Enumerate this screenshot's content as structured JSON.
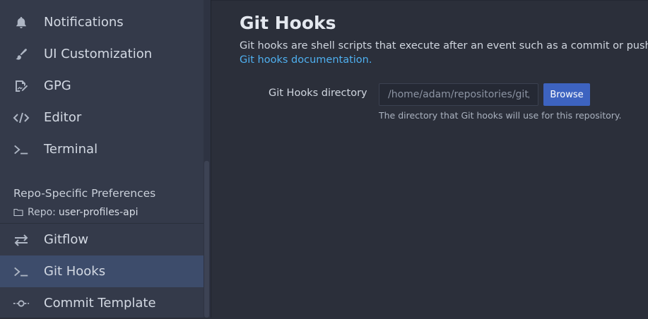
{
  "sidebar": {
    "global_items": [
      {
        "label": "Notifications",
        "icon": "bell-icon"
      },
      {
        "label": "UI Customization",
        "icon": "paintbrush-icon"
      },
      {
        "label": "GPG",
        "icon": "signature-icon"
      },
      {
        "label": "Editor",
        "icon": "code-icon"
      },
      {
        "label": "Terminal",
        "icon": "terminal-icon"
      }
    ],
    "repo_section": {
      "title": "Repo-Specific Preferences",
      "repo_prefix": "Repo:",
      "repo_name": "user-profiles-api"
    },
    "repo_items": [
      {
        "label": "Gitflow",
        "icon": "arrows-swap-icon"
      },
      {
        "label": "Git Hooks",
        "icon": "terminal-icon",
        "active": true
      },
      {
        "label": "Commit Template",
        "icon": "commit-icon"
      }
    ]
  },
  "main": {
    "title": "Git Hooks",
    "description": "Git hooks are shell scripts that execute after an event such as a commit or push. For more",
    "doc_link": "Git hooks documentation.",
    "field": {
      "label": "Git Hooks directory",
      "value": "/home/adam/repositories/git/C",
      "button": "Browse",
      "help": "The directory that Git hooks will use for this repository."
    }
  },
  "colors": {
    "accent": "#3d63c0",
    "link": "#4fb0f0",
    "active_item": "#3d4c6b",
    "sidebar_bg": "#343a4a",
    "main_bg": "#2b2f3a"
  }
}
